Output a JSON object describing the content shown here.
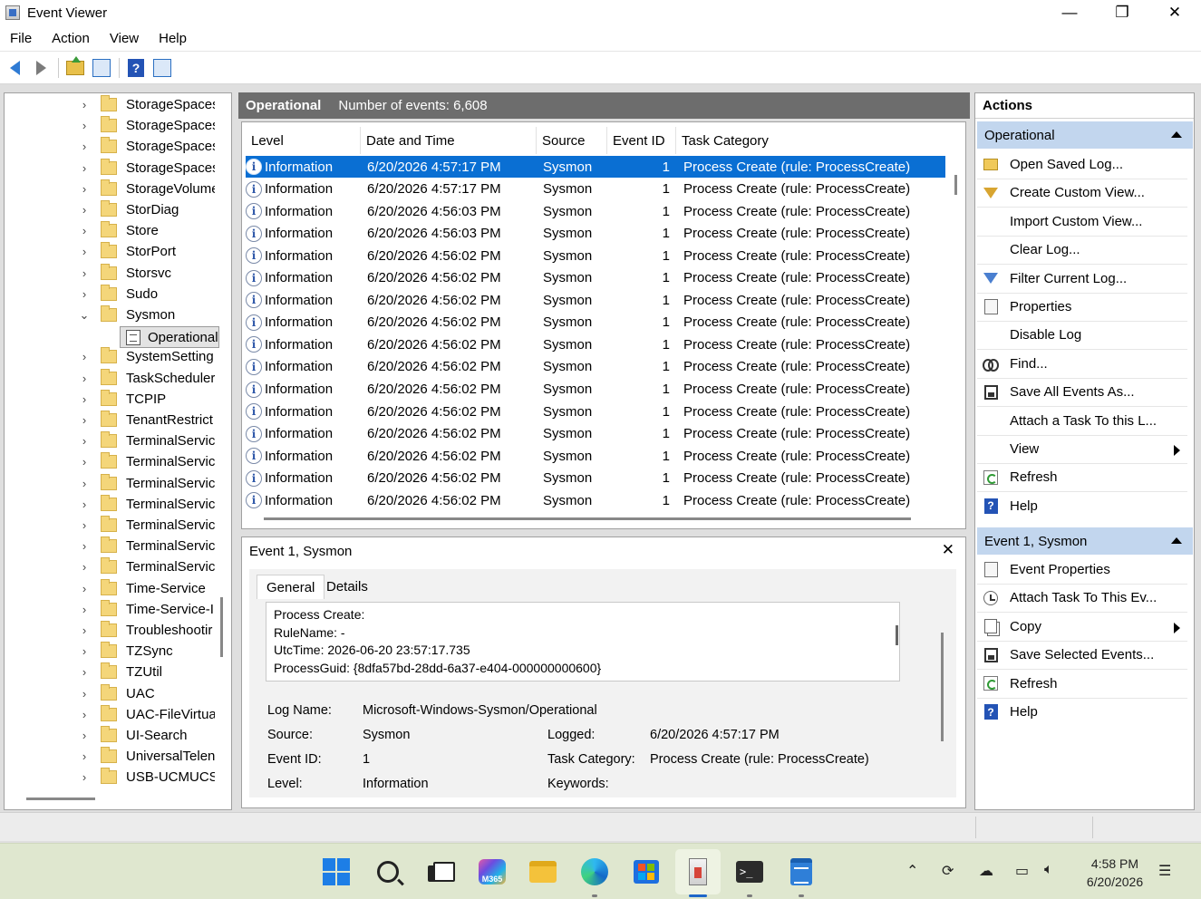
{
  "window": {
    "title": "Event Viewer",
    "minimize": "—",
    "maximize": "❐",
    "close": "✕"
  },
  "menu": [
    "File",
    "Action",
    "View",
    "Help"
  ],
  "tree": {
    "items": [
      "StorageSpaces",
      "StorageSpaces",
      "StorageSpaces",
      "StorageSpaces",
      "StorageVolume",
      "StorDiag",
      "Store",
      "StorPort",
      "Storsvc",
      "Sudo",
      "Sysmon",
      "",
      "SystemSetting",
      "TaskScheduler",
      "TCPIP",
      "TenantRestrict",
      "TerminalServic",
      "TerminalServic",
      "TerminalServic",
      "TerminalServic",
      "TerminalServic",
      "TerminalServic",
      "TerminalServic",
      "Time-Service",
      "Time-Service-I",
      "Troubleshootir",
      "TZSync",
      "TZUtil",
      "UAC",
      "UAC-FileVirtua",
      "UI-Search",
      "UniversalTelen",
      "USB-UCMUCS"
    ],
    "selected_child": "Operational"
  },
  "list": {
    "header_title": "Operational",
    "header_count": "Number of events: 6,608",
    "columns": [
      "Level",
      "Date and Time",
      "Source",
      "Event ID",
      "Task Category"
    ],
    "rows": [
      {
        "level": "Information",
        "datetime": "6/20/2026 4:57:17 PM",
        "source": "Sysmon",
        "event_id": "1",
        "task": "Process Create (rule: ProcessCreate)"
      },
      {
        "level": "Information",
        "datetime": "6/20/2026 4:57:17 PM",
        "source": "Sysmon",
        "event_id": "1",
        "task": "Process Create (rule: ProcessCreate)"
      },
      {
        "level": "Information",
        "datetime": "6/20/2026 4:56:03 PM",
        "source": "Sysmon",
        "event_id": "1",
        "task": "Process Create (rule: ProcessCreate)"
      },
      {
        "level": "Information",
        "datetime": "6/20/2026 4:56:03 PM",
        "source": "Sysmon",
        "event_id": "1",
        "task": "Process Create (rule: ProcessCreate)"
      },
      {
        "level": "Information",
        "datetime": "6/20/2026 4:56:02 PM",
        "source": "Sysmon",
        "event_id": "1",
        "task": "Process Create (rule: ProcessCreate)"
      },
      {
        "level": "Information",
        "datetime": "6/20/2026 4:56:02 PM",
        "source": "Sysmon",
        "event_id": "1",
        "task": "Process Create (rule: ProcessCreate)"
      },
      {
        "level": "Information",
        "datetime": "6/20/2026 4:56:02 PM",
        "source": "Sysmon",
        "event_id": "1",
        "task": "Process Create (rule: ProcessCreate)"
      },
      {
        "level": "Information",
        "datetime": "6/20/2026 4:56:02 PM",
        "source": "Sysmon",
        "event_id": "1",
        "task": "Process Create (rule: ProcessCreate)"
      },
      {
        "level": "Information",
        "datetime": "6/20/2026 4:56:02 PM",
        "source": "Sysmon",
        "event_id": "1",
        "task": "Process Create (rule: ProcessCreate)"
      },
      {
        "level": "Information",
        "datetime": "6/20/2026 4:56:02 PM",
        "source": "Sysmon",
        "event_id": "1",
        "task": "Process Create (rule: ProcessCreate)"
      },
      {
        "level": "Information",
        "datetime": "6/20/2026 4:56:02 PM",
        "source": "Sysmon",
        "event_id": "1",
        "task": "Process Create (rule: ProcessCreate)"
      },
      {
        "level": "Information",
        "datetime": "6/20/2026 4:56:02 PM",
        "source": "Sysmon",
        "event_id": "1",
        "task": "Process Create (rule: ProcessCreate)"
      },
      {
        "level": "Information",
        "datetime": "6/20/2026 4:56:02 PM",
        "source": "Sysmon",
        "event_id": "1",
        "task": "Process Create (rule: ProcessCreate)"
      },
      {
        "level": "Information",
        "datetime": "6/20/2026 4:56:02 PM",
        "source": "Sysmon",
        "event_id": "1",
        "task": "Process Create (rule: ProcessCreate)"
      },
      {
        "level": "Information",
        "datetime": "6/20/2026 4:56:02 PM",
        "source": "Sysmon",
        "event_id": "1",
        "task": "Process Create (rule: ProcessCreate)"
      },
      {
        "level": "Information",
        "datetime": "6/20/2026 4:56:02 PM",
        "source": "Sysmon",
        "event_id": "1",
        "task": "Process Create (rule: ProcessCreate)"
      }
    ]
  },
  "detail": {
    "title": "Event 1, Sysmon",
    "close": "✕",
    "tabs": [
      "General",
      "Details"
    ],
    "description": [
      "Process Create:",
      "RuleName: -",
      "UtcTime: 2026-06-20 23:57:17.735",
      "ProcessGuid: {8dfa57bd-28dd-6a37-e404-000000000600}"
    ],
    "fields": {
      "log_name_label": "Log Name:",
      "log_name": "Microsoft-Windows-Sysmon/Operational",
      "source_label": "Source:",
      "source": "Sysmon",
      "logged_label": "Logged:",
      "logged": "6/20/2026 4:57:17 PM",
      "event_id_label": "Event ID:",
      "event_id": "1",
      "task_label": "Task Category:",
      "task": "Process Create (rule: ProcessCreate)",
      "level_label": "Level:",
      "level": "Information",
      "keywords_label": "Keywords:"
    }
  },
  "actions": {
    "title": "Actions",
    "section1": "Operational",
    "items1": [
      {
        "label": "Open Saved Log...",
        "icon": "open-folder-icon"
      },
      {
        "label": "Create Custom View...",
        "icon": "create-filter-icon"
      },
      {
        "label": "Import Custom View...",
        "icon": ""
      },
      {
        "label": "Clear Log...",
        "icon": ""
      },
      {
        "label": "Filter Current Log...",
        "icon": "filter-icon"
      },
      {
        "label": "Properties",
        "icon": "properties-icon"
      },
      {
        "label": "Disable Log",
        "icon": ""
      },
      {
        "label": "Find...",
        "icon": "binoculars-icon"
      },
      {
        "label": "Save All Events As...",
        "icon": "save-icon"
      },
      {
        "label": "Attach a Task To this L...",
        "icon": ""
      },
      {
        "label": "View",
        "icon": "",
        "submenu": true
      },
      {
        "label": "Refresh",
        "icon": "refresh-icon"
      },
      {
        "label": "Help",
        "icon": "help-icon"
      }
    ],
    "section2": "Event 1, Sysmon",
    "items2": [
      {
        "label": "Event Properties",
        "icon": "properties-icon"
      },
      {
        "label": "Attach Task To This Ev...",
        "icon": "task-icon"
      },
      {
        "label": "Copy",
        "icon": "copy-icon",
        "submenu": true
      },
      {
        "label": "Save Selected Events...",
        "icon": "save-icon"
      },
      {
        "label": "Refresh",
        "icon": "refresh-icon"
      },
      {
        "label": "Help",
        "icon": "help-icon"
      }
    ]
  },
  "taskbar": {
    "m365_label": "M365",
    "terminal_glyph": ">_",
    "clock_time": "4:58 PM",
    "clock_date": "6/20/2026"
  }
}
